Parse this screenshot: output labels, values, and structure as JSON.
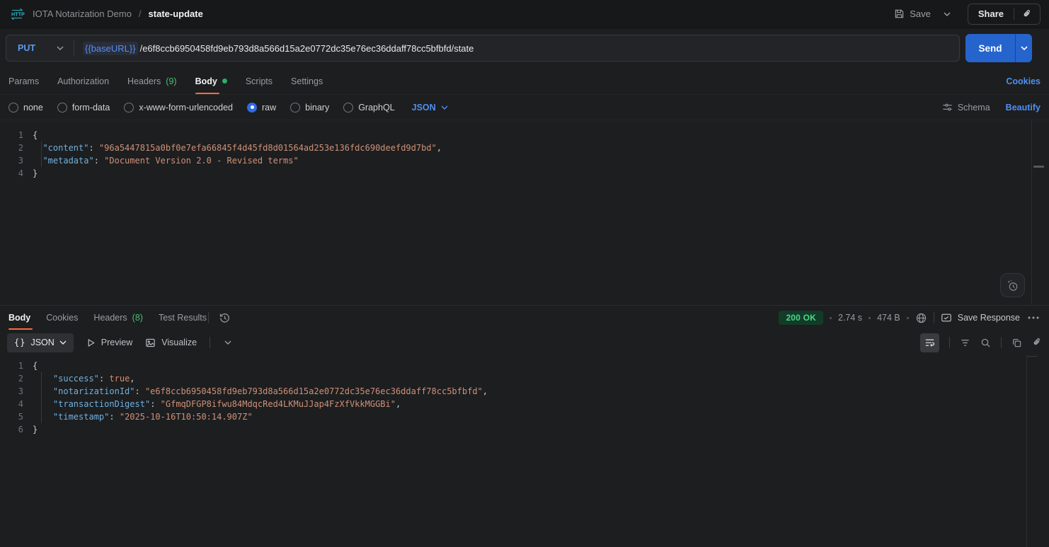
{
  "colors": {
    "accent_orange": "#ff6c37",
    "link_blue": "#4e8ff0",
    "method_blue": "#5b9bf0",
    "send_blue": "#2564cd",
    "success_green": "#47c078",
    "variable_blue": "#5a8def",
    "icon_teal": "#2cb5c8"
  },
  "topbar": {
    "collection": "IOTA Notarization Demo",
    "separator": "/",
    "request_name": "state-update",
    "save": "Save",
    "share": "Share"
  },
  "request": {
    "method": "PUT",
    "url": {
      "variable": "{{baseURL}}",
      "path": "/e6f8ccb6950458fd9eb793d8a566d15a2e0772dc35e76ec36ddaff78cc5bfbfd/state"
    },
    "send": "Send",
    "tabs": {
      "params": "Params",
      "authorization": "Authorization",
      "headers": "Headers",
      "headers_count": "(9)",
      "body": "Body",
      "scripts": "Scripts",
      "settings": "Settings"
    },
    "cookies": "Cookies",
    "body_types": {
      "none": "none",
      "form_data": "form-data",
      "urlencoded": "x-www-form-urlencoded",
      "raw": "raw",
      "binary": "binary",
      "graphql": "GraphQL"
    },
    "selected_body_type": "raw",
    "raw_language": "JSON",
    "schema": "Schema",
    "beautify": "Beautify",
    "editor": {
      "lines": [
        {
          "n": "1",
          "tk": [
            {
              "t": "p",
              "v": "{"
            }
          ]
        },
        {
          "n": "2",
          "tk": [
            {
              "t": "w",
              "v": "  "
            },
            {
              "t": "k",
              "v": "\"content\""
            },
            {
              "t": "p",
              "v": ": "
            },
            {
              "t": "s",
              "v": "\"96a5447815a0bf0e7efa66845f4d45fd8d01564ad253e136fdc690deefd9d7bd\""
            },
            {
              "t": "p",
              "v": ","
            }
          ]
        },
        {
          "n": "3",
          "tk": [
            {
              "t": "w",
              "v": "  "
            },
            {
              "t": "k",
              "v": "\"metadata\""
            },
            {
              "t": "p",
              "v": ": "
            },
            {
              "t": "s",
              "v": "\"Document Version 2.0 - Revised terms\""
            }
          ]
        },
        {
          "n": "4",
          "tk": [
            {
              "t": "p",
              "v": "}"
            }
          ]
        }
      ]
    }
  },
  "response": {
    "tabs": {
      "body": "Body",
      "cookies": "Cookies",
      "headers": "Headers",
      "headers_count": "(8)",
      "test_results": "Test Results"
    },
    "status": "200 OK",
    "time": "2.74 s",
    "size": "474 B",
    "save_response": "Save Response",
    "toolbar": {
      "format_braces": "{}",
      "format": "JSON",
      "preview": "Preview",
      "visualize": "Visualize"
    },
    "editor": {
      "lines": [
        {
          "n": "1",
          "tk": [
            {
              "t": "p",
              "v": "{"
            }
          ]
        },
        {
          "n": "2",
          "tk": [
            {
              "t": "w",
              "v": "    "
            },
            {
              "t": "k",
              "v": "\"success\""
            },
            {
              "t": "p",
              "v": ": "
            },
            {
              "t": "b",
              "v": "true"
            },
            {
              "t": "p",
              "v": ","
            }
          ]
        },
        {
          "n": "3",
          "tk": [
            {
              "t": "w",
              "v": "    "
            },
            {
              "t": "k",
              "v": "\"notarizationId\""
            },
            {
              "t": "p",
              "v": ": "
            },
            {
              "t": "s",
              "v": "\"e6f8ccb6950458fd9eb793d8a566d15a2e0772dc35e76ec36ddaff78cc5bfbfd\""
            },
            {
              "t": "p",
              "v": ","
            }
          ]
        },
        {
          "n": "4",
          "tk": [
            {
              "t": "w",
              "v": "    "
            },
            {
              "t": "k",
              "v": "\"transactionDigest\""
            },
            {
              "t": "p",
              "v": ": "
            },
            {
              "t": "s",
              "v": "\"GfmqDFGP8ifwu84MdqcRed4LKMuJJap4FzXfVkkMGGBi\""
            },
            {
              "t": "p",
              "v": ","
            }
          ]
        },
        {
          "n": "5",
          "tk": [
            {
              "t": "w",
              "v": "    "
            },
            {
              "t": "k",
              "v": "\"timestamp\""
            },
            {
              "t": "p",
              "v": ": "
            },
            {
              "t": "s",
              "v": "\"2025-10-16T10:50:14.907Z\""
            }
          ]
        },
        {
          "n": "6",
          "tk": [
            {
              "t": "p",
              "v": "}"
            }
          ]
        }
      ]
    }
  }
}
